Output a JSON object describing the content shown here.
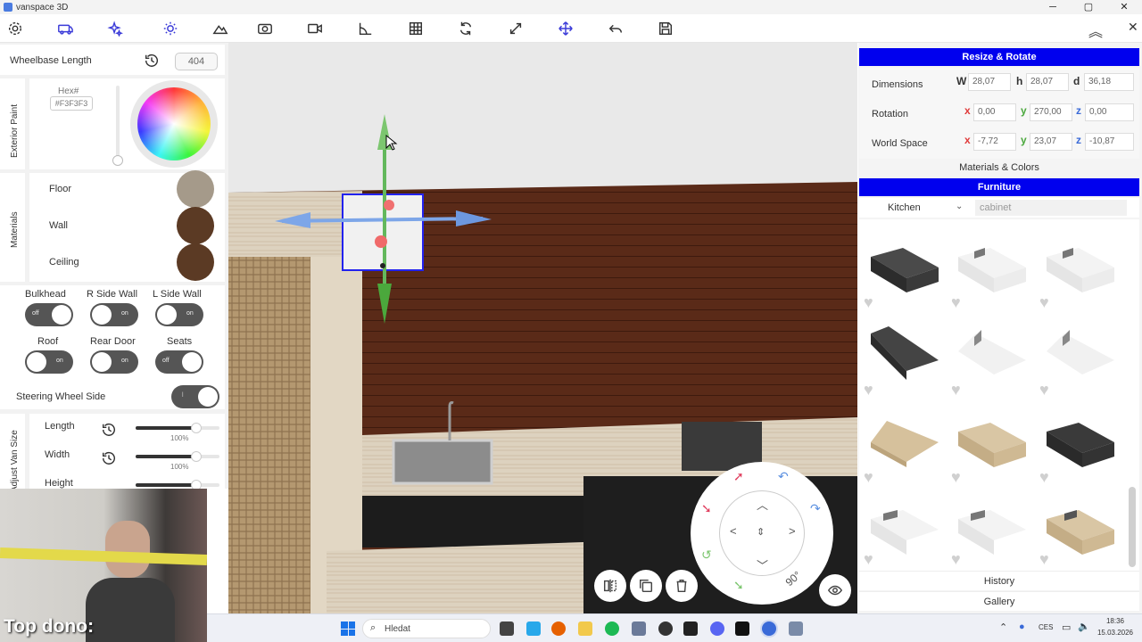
{
  "window": {
    "title": "vanspace 3D",
    "min": "─",
    "max": "▢",
    "close": "✕"
  },
  "toolbar": {
    "icons": [
      "gear-icon",
      "van-icon",
      "sparkle-icon",
      "sun-icon",
      "mountain-icon",
      "camera-icon",
      "video-icon",
      "ruler-angle-icon",
      "grid-icon",
      "refresh-icon",
      "expand-icon",
      "move-icon",
      "undo-icon",
      "save-icon"
    ],
    "collapse": "︽",
    "close": "✕"
  },
  "left": {
    "wheelbase": {
      "label": "Wheelbase Length",
      "value": "404"
    },
    "exterior": {
      "section": "Exterior Paint",
      "hex_label": "Hex#",
      "hex_value": "#F3F3F3"
    },
    "materials": {
      "section": "Materials",
      "items": [
        {
          "label": "Floor",
          "color": "#a59a8a"
        },
        {
          "label": "Wall",
          "color": "#5b3a24"
        },
        {
          "label": "Ceiling",
          "color": "#5b3a24"
        }
      ]
    },
    "toggles": [
      {
        "label": "Bulkhead",
        "state": "off"
      },
      {
        "label": "R Side Wall",
        "state": "on"
      },
      {
        "label": "L Side Wall",
        "state": "on"
      },
      {
        "label": "Roof",
        "state": "on"
      },
      {
        "label": "Rear Door",
        "state": "on"
      },
      {
        "label": "Seats",
        "state": "off"
      }
    ],
    "steering": {
      "label": "Steering Wheel Side",
      "knob": "l"
    },
    "van_size": {
      "section": "Adjust Van Size",
      "rows": [
        {
          "label": "Length",
          "value": "100%",
          "level": 0.72
        },
        {
          "label": "Width",
          "value": "100%",
          "level": 0.72
        },
        {
          "label": "Height",
          "value": "",
          "level": 0.72
        }
      ]
    }
  },
  "webcam": {
    "caption": "Top dono:"
  },
  "viewport": {
    "controls": {
      "angle": "90°"
    }
  },
  "right": {
    "resize": {
      "title": "Resize & Rotate",
      "dimensions": {
        "label": "Dimensions",
        "w": "28,07",
        "h": "28,07",
        "d": "36,18"
      },
      "rotation": {
        "label": "Rotation",
        "x": "0,00",
        "y": "270,00",
        "z": "0,00"
      },
      "world": {
        "label": "World Space",
        "x": "-7,72",
        "y": "23,07",
        "z": "-10,87"
      },
      "axes": {
        "w": "W",
        "h": "h",
        "d": "d",
        "x": "x",
        "y": "y",
        "z": "z"
      }
    },
    "materials_colors": "Materials & Colors",
    "furniture": {
      "title": "Furniture",
      "category": "Kitchen",
      "search_placeholder": "cabinet",
      "items": [
        {
          "style": "black"
        },
        {
          "style": "white"
        },
        {
          "style": "white"
        },
        {
          "style": "black"
        },
        {
          "style": "white"
        },
        {
          "style": "white"
        },
        {
          "style": "wood"
        },
        {
          "style": "wood"
        },
        {
          "style": "black"
        },
        {
          "style": "white"
        },
        {
          "style": "white"
        },
        {
          "style": "wood"
        }
      ]
    },
    "history": "History",
    "gallery": "Gallery"
  },
  "taskbar": {
    "search": "Hledat",
    "lang": "CES",
    "time": "18:36",
    "date": "15.03.2026"
  }
}
